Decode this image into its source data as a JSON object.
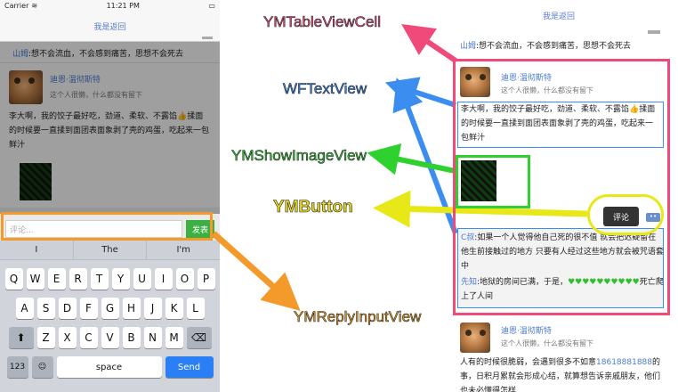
{
  "phone": {
    "status": {
      "carrier": "Carrier",
      "time": "11:21 PM"
    },
    "nav_title": "我是返回",
    "top_comment": {
      "name": "山姆",
      "text": ":想不会流血，不会感到痛苦，思想不会死去"
    },
    "cell": {
      "name": "迪恩·温彻斯特",
      "signature": "这个人很懒，什么都没有留下",
      "text": "李大啊，我的饺子最好吃，劲道、柔软、不露馅👍揉面的时候要一直揉到面团表面象剥了壳的鸡蛋，吃起来一包鲜汁"
    },
    "reply": {
      "placeholder": "评论...",
      "send": "发表"
    },
    "suggestions": [
      "I",
      "The",
      "I'm"
    ],
    "keyboard": {
      "row1": [
        "Q",
        "W",
        "E",
        "R",
        "T",
        "Y",
        "U",
        "I",
        "O",
        "P"
      ],
      "row2": [
        "A",
        "S",
        "D",
        "F",
        "G",
        "H",
        "J",
        "K",
        "L"
      ],
      "row3": [
        "Z",
        "X",
        "C",
        "V",
        "B",
        "N",
        "M"
      ],
      "shift": "⬆",
      "delete": "⌫",
      "num": "123",
      "emoji": "☺",
      "space": "space",
      "send": "Send"
    }
  },
  "labels": {
    "cell": "YMTableViewCell",
    "textview": "WFTextView",
    "imageview": "YMShowImageView",
    "button": "YMButton",
    "reply": "YMReplyInputView"
  },
  "right": {
    "nav_title": "我是返回",
    "top_comment": {
      "name": "山姆",
      "text": ":想不会流血，不会感到痛苦，思想不会死去"
    },
    "cell": {
      "name": "迪恩·温彻斯特",
      "signature": "这个人很懒，什么都没有留下",
      "text": "李大啊，我的饺子最好吃，劲道、柔软、不露馅👍揉面的时候要一直揉到面团表面象剥了壳的鸡蛋，吃起来一包鲜汁"
    },
    "popup": "评论",
    "more": "••",
    "comments": [
      {
        "name": "C叔",
        "text": ":如果一个人觉得他自己死的很不值 就会把迟疑留在他生前接触过的地方 只要有人经过这些地方就会被咒语套中"
      },
      {
        "name": "先知",
        "text": ":地狱的房间已满，于是，",
        "hearts": "♥♥♥♥♥♥♥♥♥♥",
        "tail": "死亡爬上了人间"
      }
    ],
    "cell2": {
      "name": "迪恩·温彻斯特",
      "signature": "这个人很懒，什么都没有留下",
      "text_a": "人有的时候很脆弱，会遇到很多不如意",
      "phone": "18618881888",
      "text_b": "的事，日积月累就会形成心结，就算想告诉亲戚朋友，他们也未必懂得怎样"
    }
  }
}
